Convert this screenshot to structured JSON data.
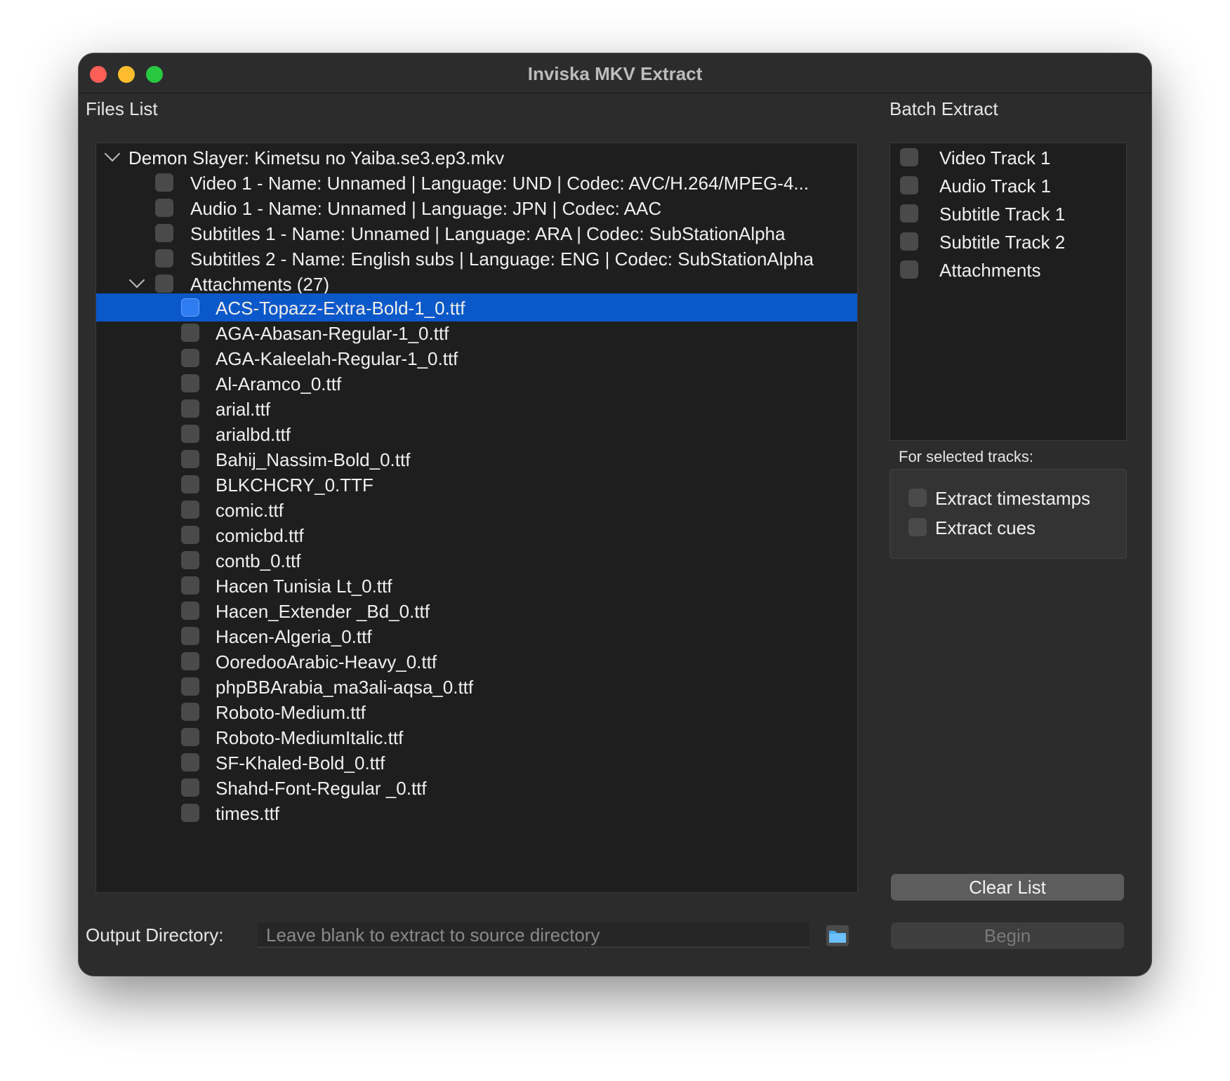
{
  "window": {
    "title": "Inviska MKV Extract"
  },
  "files_list": {
    "label": "Files List",
    "file": "Demon Slayer: Kimetsu no Yaiba.se3.ep3.mkv",
    "tracks": [
      "Video 1 - Name: Unnamed | Language: UND | Codec: AVC/H.264/MPEG-4...",
      "Audio 1 - Name: Unnamed | Language: JPN | Codec: AAC",
      "Subtitles 1 - Name: Unnamed | Language: ARA | Codec: SubStationAlpha",
      "Subtitles 2 - Name: English subs | Language: ENG | Codec: SubStationAlpha"
    ],
    "attachments_label": "Attachments (27)",
    "attachments": [
      "ACS-Topazz-Extra-Bold-1_0.ttf",
      "AGA-Abasan-Regular-1_0.ttf",
      "AGA-Kaleelah-Regular-1_0.ttf",
      "Al-Aramco_0.ttf",
      "arial.ttf",
      "arialbd.ttf",
      "Bahij_Nassim-Bold_0.ttf",
      "BLKCHCRY_0.TTF",
      "comic.ttf",
      "comicbd.ttf",
      "contb_0.ttf",
      "Hacen Tunisia Lt_0.ttf",
      "Hacen_Extender _Bd_0.ttf",
      "Hacen-Algeria_0.ttf",
      "OoredooArabic-Heavy_0.ttf",
      "phpBBArabia_ma3ali-aqsa_0.ttf",
      "Roboto-Medium.ttf",
      "Roboto-MediumItalic.ttf",
      "SF-Khaled-Bold_0.ttf",
      "Shahd-Font-Regular _0.ttf",
      "times.ttf"
    ]
  },
  "batch_extract": {
    "label": "Batch Extract",
    "items": [
      "Video Track 1",
      "Audio Track 1",
      "Subtitle Track 1",
      "Subtitle Track 2",
      "Attachments"
    ]
  },
  "selected_tracks": {
    "label": "For selected tracks:",
    "options": [
      "Extract timestamps",
      "Extract cues"
    ]
  },
  "buttons": {
    "clear": "Clear List",
    "begin": "Begin"
  },
  "output": {
    "label": "Output Directory:",
    "placeholder": "Leave blank to extract to source directory"
  },
  "colors": {
    "selection": "#0a58ca",
    "close": "#ff5f57",
    "minimize": "#febc2e",
    "maximize": "#28c840",
    "folder": "#4aa8f0"
  },
  "icons": [
    "chevron-down-icon",
    "folder-icon"
  ]
}
